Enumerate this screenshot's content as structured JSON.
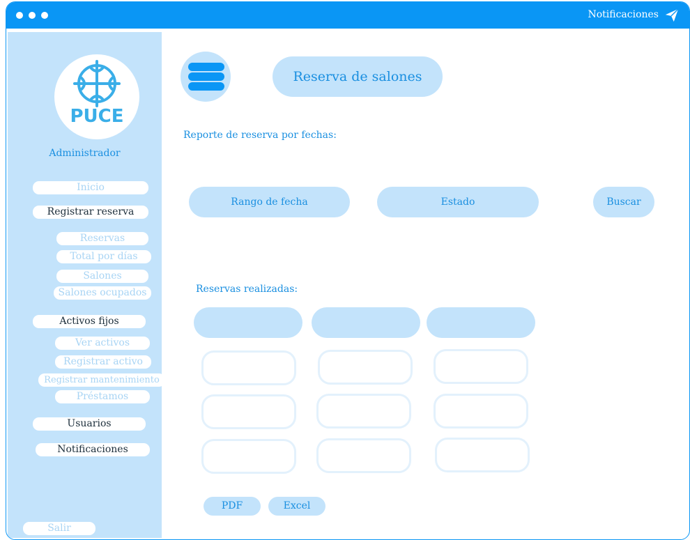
{
  "topbar": {
    "notifications_label": "Notificaciones"
  },
  "sidebar": {
    "logo_text": "PUCE",
    "role": "Administrador",
    "items": [
      {
        "label": "Inicio"
      },
      {
        "label": "Registrar reserva"
      },
      {
        "label": "Reservas"
      },
      {
        "label": "Total por días"
      },
      {
        "label": "Salones"
      },
      {
        "label": "Salones ocupados"
      },
      {
        "label": "Activos fijos"
      },
      {
        "label": "Ver activos"
      },
      {
        "label": "Registrar activo"
      },
      {
        "label": "Registrar mantenimiento"
      },
      {
        "label": "Préstamos"
      },
      {
        "label": "Usuarios"
      },
      {
        "label": "Notificaciones"
      },
      {
        "label": "Salir"
      }
    ]
  },
  "main": {
    "title": "Reserva de salones",
    "report_label": "Reporte de reserva por fechas:",
    "filters": {
      "date_range": "Rango de fecha",
      "status": "Estado",
      "search": "Buscar"
    },
    "table_label": "Reservas realizadas:",
    "export": {
      "pdf": "PDF",
      "excel": "Excel"
    }
  },
  "colors": {
    "accent": "#0a96f5",
    "light": "#c3e3fb",
    "text_accent": "#1a8fe0"
  }
}
